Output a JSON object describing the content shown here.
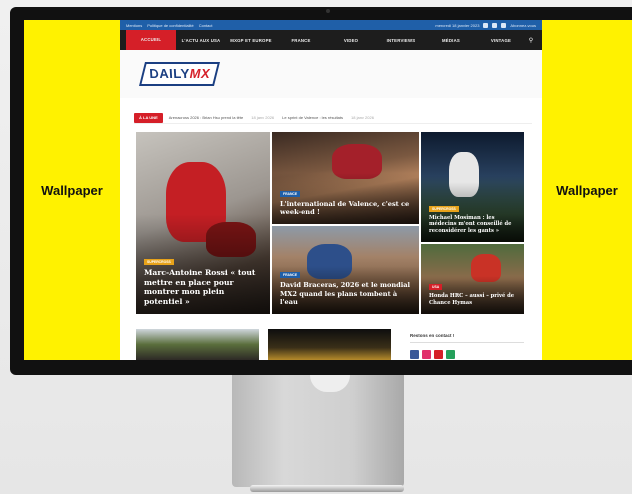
{
  "wallpaper": {
    "left_label": "Wallpaper",
    "right_label": "Wallpaper",
    "color": "#fff200"
  },
  "topbar": {
    "links": [
      "Mentions",
      "Politique de confidentialité",
      "Contact"
    ],
    "date": "mercredi 18 janvier 2023",
    "account": "Abonnez-vous"
  },
  "nav": {
    "items": [
      "ACCUEIL",
      "L'ACTU AUX USA",
      "MXGP ET EUROPE",
      "FRANCE",
      "VIDEO",
      "INTERVIEWS",
      "MÉDIAS",
      "VINTAGE"
    ],
    "active_index": 0,
    "accent": "#d51f28"
  },
  "brand": {
    "logo_main": "DAILY",
    "logo_accent": "MX"
  },
  "ticker": {
    "badge": "À LA UNE",
    "items": [
      {
        "text": "Arenacross 2026 : Brian Hsu prend la tête",
        "date": "18 janv 2026"
      },
      {
        "text": "Le sprint de Valence : les résultats",
        "date": "18 janv 2026"
      }
    ]
  },
  "articles": [
    {
      "tag": "SUPERCROSS",
      "tag_color": "#e7a21a",
      "title": "Marc-Antoine Rossi « tout mettre en place pour montrer mon plein potentiel »"
    },
    {
      "tag": "FRANCE",
      "tag_color": "#1f5fa8",
      "title": "L'international de Valence, c'est ce week-end !"
    },
    {
      "tag": "SUPERCROSS",
      "tag_color": "#e7a21a",
      "title": "Michael Mosiman : les médecins m'ont conseillé de reconsidérer les gants »"
    },
    {
      "tag": "FRANCE",
      "tag_color": "#1f5fa8",
      "title": "David Braceras, 2026 et le mondial MX2 quand les plans tombent à l'eau"
    },
    {
      "tag": "USA",
      "tag_color": "#d51f28",
      "title": "Honda HRC – aussi – privé de Chance Hymas"
    }
  ],
  "social": {
    "heading": "Restons en contact !",
    "colors": [
      "#3b5998",
      "#e1306c",
      "#d51f28",
      "#25a05b"
    ]
  }
}
